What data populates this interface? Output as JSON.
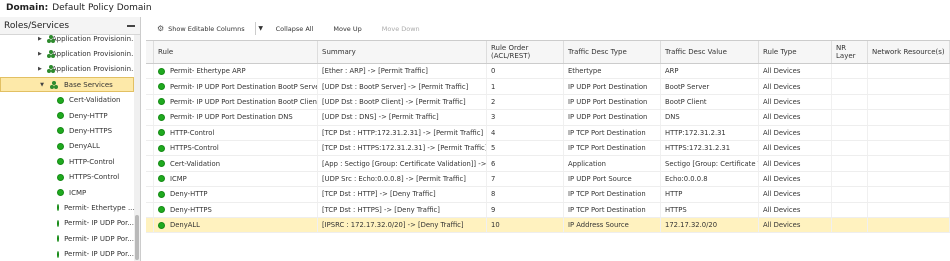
{
  "domain": {
    "label": "Domain:",
    "value": "Default Policy Domain"
  },
  "left_panel": {
    "title": "Roles/Services",
    "tree": [
      {
        "label": "Application Provisionin...",
        "kind": "group",
        "expanded": false
      },
      {
        "label": "Application Provisionin...",
        "kind": "group",
        "expanded": false
      },
      {
        "label": "Application Provisionin...",
        "kind": "group",
        "expanded": false
      },
      {
        "label": "Base Services",
        "kind": "group",
        "expanded": true,
        "selected": true
      },
      {
        "label": "Cert-Validation",
        "kind": "service"
      },
      {
        "label": "Deny-HTTP",
        "kind": "service"
      },
      {
        "label": "Deny-HTTPS",
        "kind": "service"
      },
      {
        "label": "DenyALL",
        "kind": "service"
      },
      {
        "label": "HTTP-Control",
        "kind": "service"
      },
      {
        "label": "HTTPS-Control",
        "kind": "service"
      },
      {
        "label": "ICMP",
        "kind": "service"
      },
      {
        "label": "Permit- Ethertype ...",
        "kind": "service"
      },
      {
        "label": "Permit- IP UDP Por...",
        "kind": "service"
      },
      {
        "label": "Permit- IP UDP Por...",
        "kind": "service"
      },
      {
        "label": "Permit- IP UDP Por...",
        "kind": "service"
      }
    ]
  },
  "toolbar": {
    "show_editable": "Show Editable Columns",
    "collapse_all": "Collapse All",
    "move_up": "Move Up",
    "move_down": "Move Down"
  },
  "table": {
    "headers": [
      "Rule",
      "Summary",
      "Rule Order (ACL/REST)",
      "Traffic Desc Type",
      "Traffic Desc Value",
      "Rule Type",
      "NR Layer",
      "Network Resource(s)"
    ],
    "rows": [
      {
        "rule": "Permit- Ethertype ARP",
        "summary": "[Ether : ARP] -> [Permit Traffic]",
        "order": "0",
        "type": "Ethertype",
        "value": "ARP",
        "rule_type": "All Devices",
        "nr_layer": "",
        "resources": ""
      },
      {
        "rule": "Permit- IP UDP Port Destination BootP Server",
        "summary": "[UDP Dst : BootP Server] -> [Permit Traffic]",
        "order": "1",
        "type": "IP UDP Port Destination",
        "value": "BootP Server",
        "rule_type": "All Devices",
        "nr_layer": "",
        "resources": ""
      },
      {
        "rule": "Permit- IP UDP Port Destination BootP Client",
        "summary": "[UDP Dst : BootP Client] -> [Permit Traffic]",
        "order": "2",
        "type": "IP UDP Port Destination",
        "value": "BootP Client",
        "rule_type": "All Devices",
        "nr_layer": "",
        "resources": ""
      },
      {
        "rule": "Permit- IP UDP Port Destination DNS",
        "summary": "[UDP Dst : DNS] -> [Permit Traffic]",
        "order": "3",
        "type": "IP UDP Port Destination",
        "value": "DNS",
        "rule_type": "All Devices",
        "nr_layer": "",
        "resources": ""
      },
      {
        "rule": "HTTP-Control",
        "summary": "[TCP Dst : HTTP:172.31.2.31] -> [Permit Traffic]",
        "order": "4",
        "type": "IP TCP Port Destination",
        "value": "HTTP:172.31.2.31",
        "rule_type": "All Devices",
        "nr_layer": "",
        "resources": ""
      },
      {
        "rule": "HTTPS-Control",
        "summary": "[TCP Dst : HTTPS:172.31.2.31] -> [Permit Traffic]",
        "order": "5",
        "type": "IP TCP Port Destination",
        "value": "HTTPS:172.31.2.31",
        "rule_type": "All Devices",
        "nr_layer": "",
        "resources": ""
      },
      {
        "rule": "Cert-Validation",
        "summary": "[App : Sectigo [Group: Certificate Validation]] -> [Permit Traffic]",
        "order": "6",
        "type": "Application",
        "value": "Sectigo [Group: Certificate V...",
        "rule_type": "All Devices",
        "nr_layer": "",
        "resources": ""
      },
      {
        "rule": "ICMP",
        "summary": "[UDP Src : Echo:0.0.0.8] -> [Permit Traffic]",
        "order": "7",
        "type": "IP UDP Port Source",
        "value": "Echo:0.0.0.8",
        "rule_type": "All Devices",
        "nr_layer": "",
        "resources": ""
      },
      {
        "rule": "Deny-HTTP",
        "summary": "[TCP Dst : HTTP] -> [Deny Traffic]",
        "order": "8",
        "type": "IP TCP Port Destination",
        "value": "HTTP",
        "rule_type": "All Devices",
        "nr_layer": "",
        "resources": ""
      },
      {
        "rule": "Deny-HTTPS",
        "summary": "[TCP Dst : HTTPS] -> [Deny Traffic]",
        "order": "9",
        "type": "IP TCP Port Destination",
        "value": "HTTPS",
        "rule_type": "All Devices",
        "nr_layer": "",
        "resources": ""
      },
      {
        "rule": "DenyALL",
        "summary": "[IPSRC : 172.17.32.0/20] -> [Deny Traffic]",
        "order": "10",
        "type": "IP Address Source",
        "value": "172.17.32.0/20",
        "rule_type": "All Devices",
        "nr_layer": "",
        "resources": "",
        "selected": true
      }
    ]
  },
  "colors": {
    "status_green": "#1faa1f",
    "selection": "#fff2bf",
    "tree_selection": "#fde9a9"
  },
  "icons": {
    "service_group": "roles-group-icon",
    "rule_status": "status-dot-icon",
    "settings": "gear-icon"
  }
}
